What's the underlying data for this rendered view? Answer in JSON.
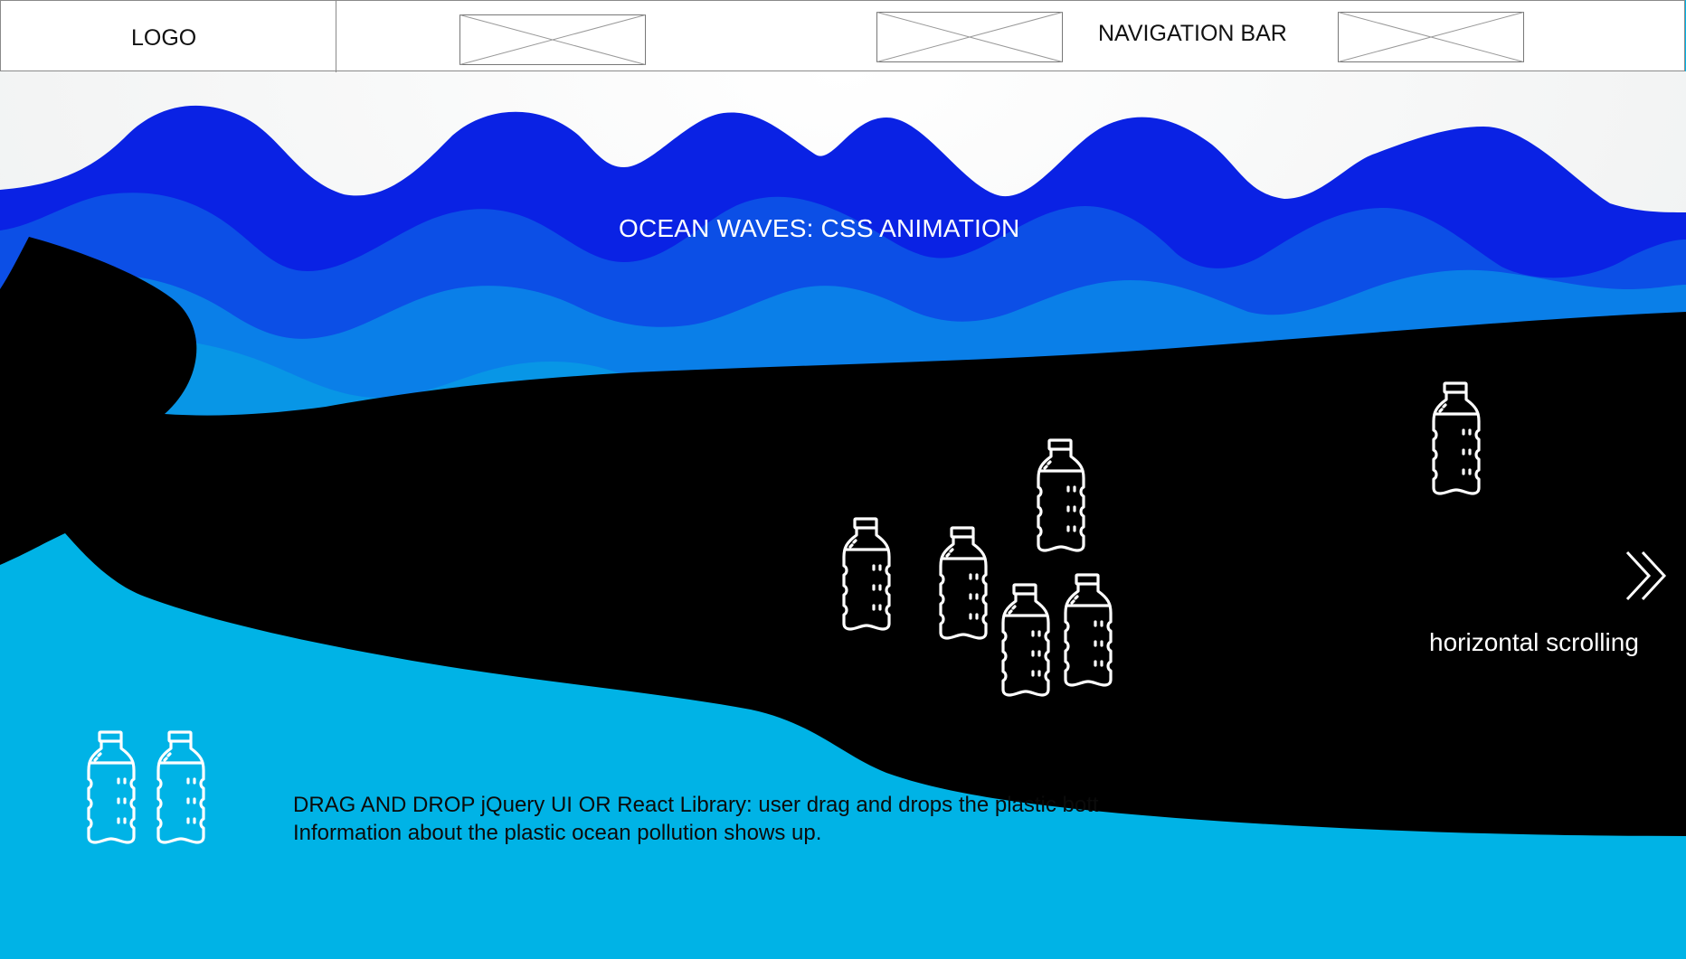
{
  "navbar": {
    "logo_label": "LOGO",
    "title": "NAVIGATION BAR",
    "placeholders": [
      "image-placeholder",
      "image-placeholder",
      "image-placeholder"
    ]
  },
  "hero": {
    "waves_label": "OCEAN WAVES: CSS ANIMATION",
    "scroll_label": "horizontal scrolling",
    "scroll_icon": "double-chevron-right-icon",
    "bottle_icon": "plastic-bottle-icon",
    "bottle_count_whale": 6,
    "bottle_count_tray": 2
  },
  "description": {
    "line1": "DRAG AND DROP jQuery UI  OR React Library: user drag and drops the plastic bott",
    "line2": "Information about the plastic ocean pollution shows up."
  },
  "colors": {
    "wave_dark": "#0b22e0",
    "wave_mid": "#0a55e6",
    "wave_light": "#0a8ae8",
    "ocean": "#00b3e6",
    "whale": "#000000",
    "sky": "#f2f3f3"
  }
}
